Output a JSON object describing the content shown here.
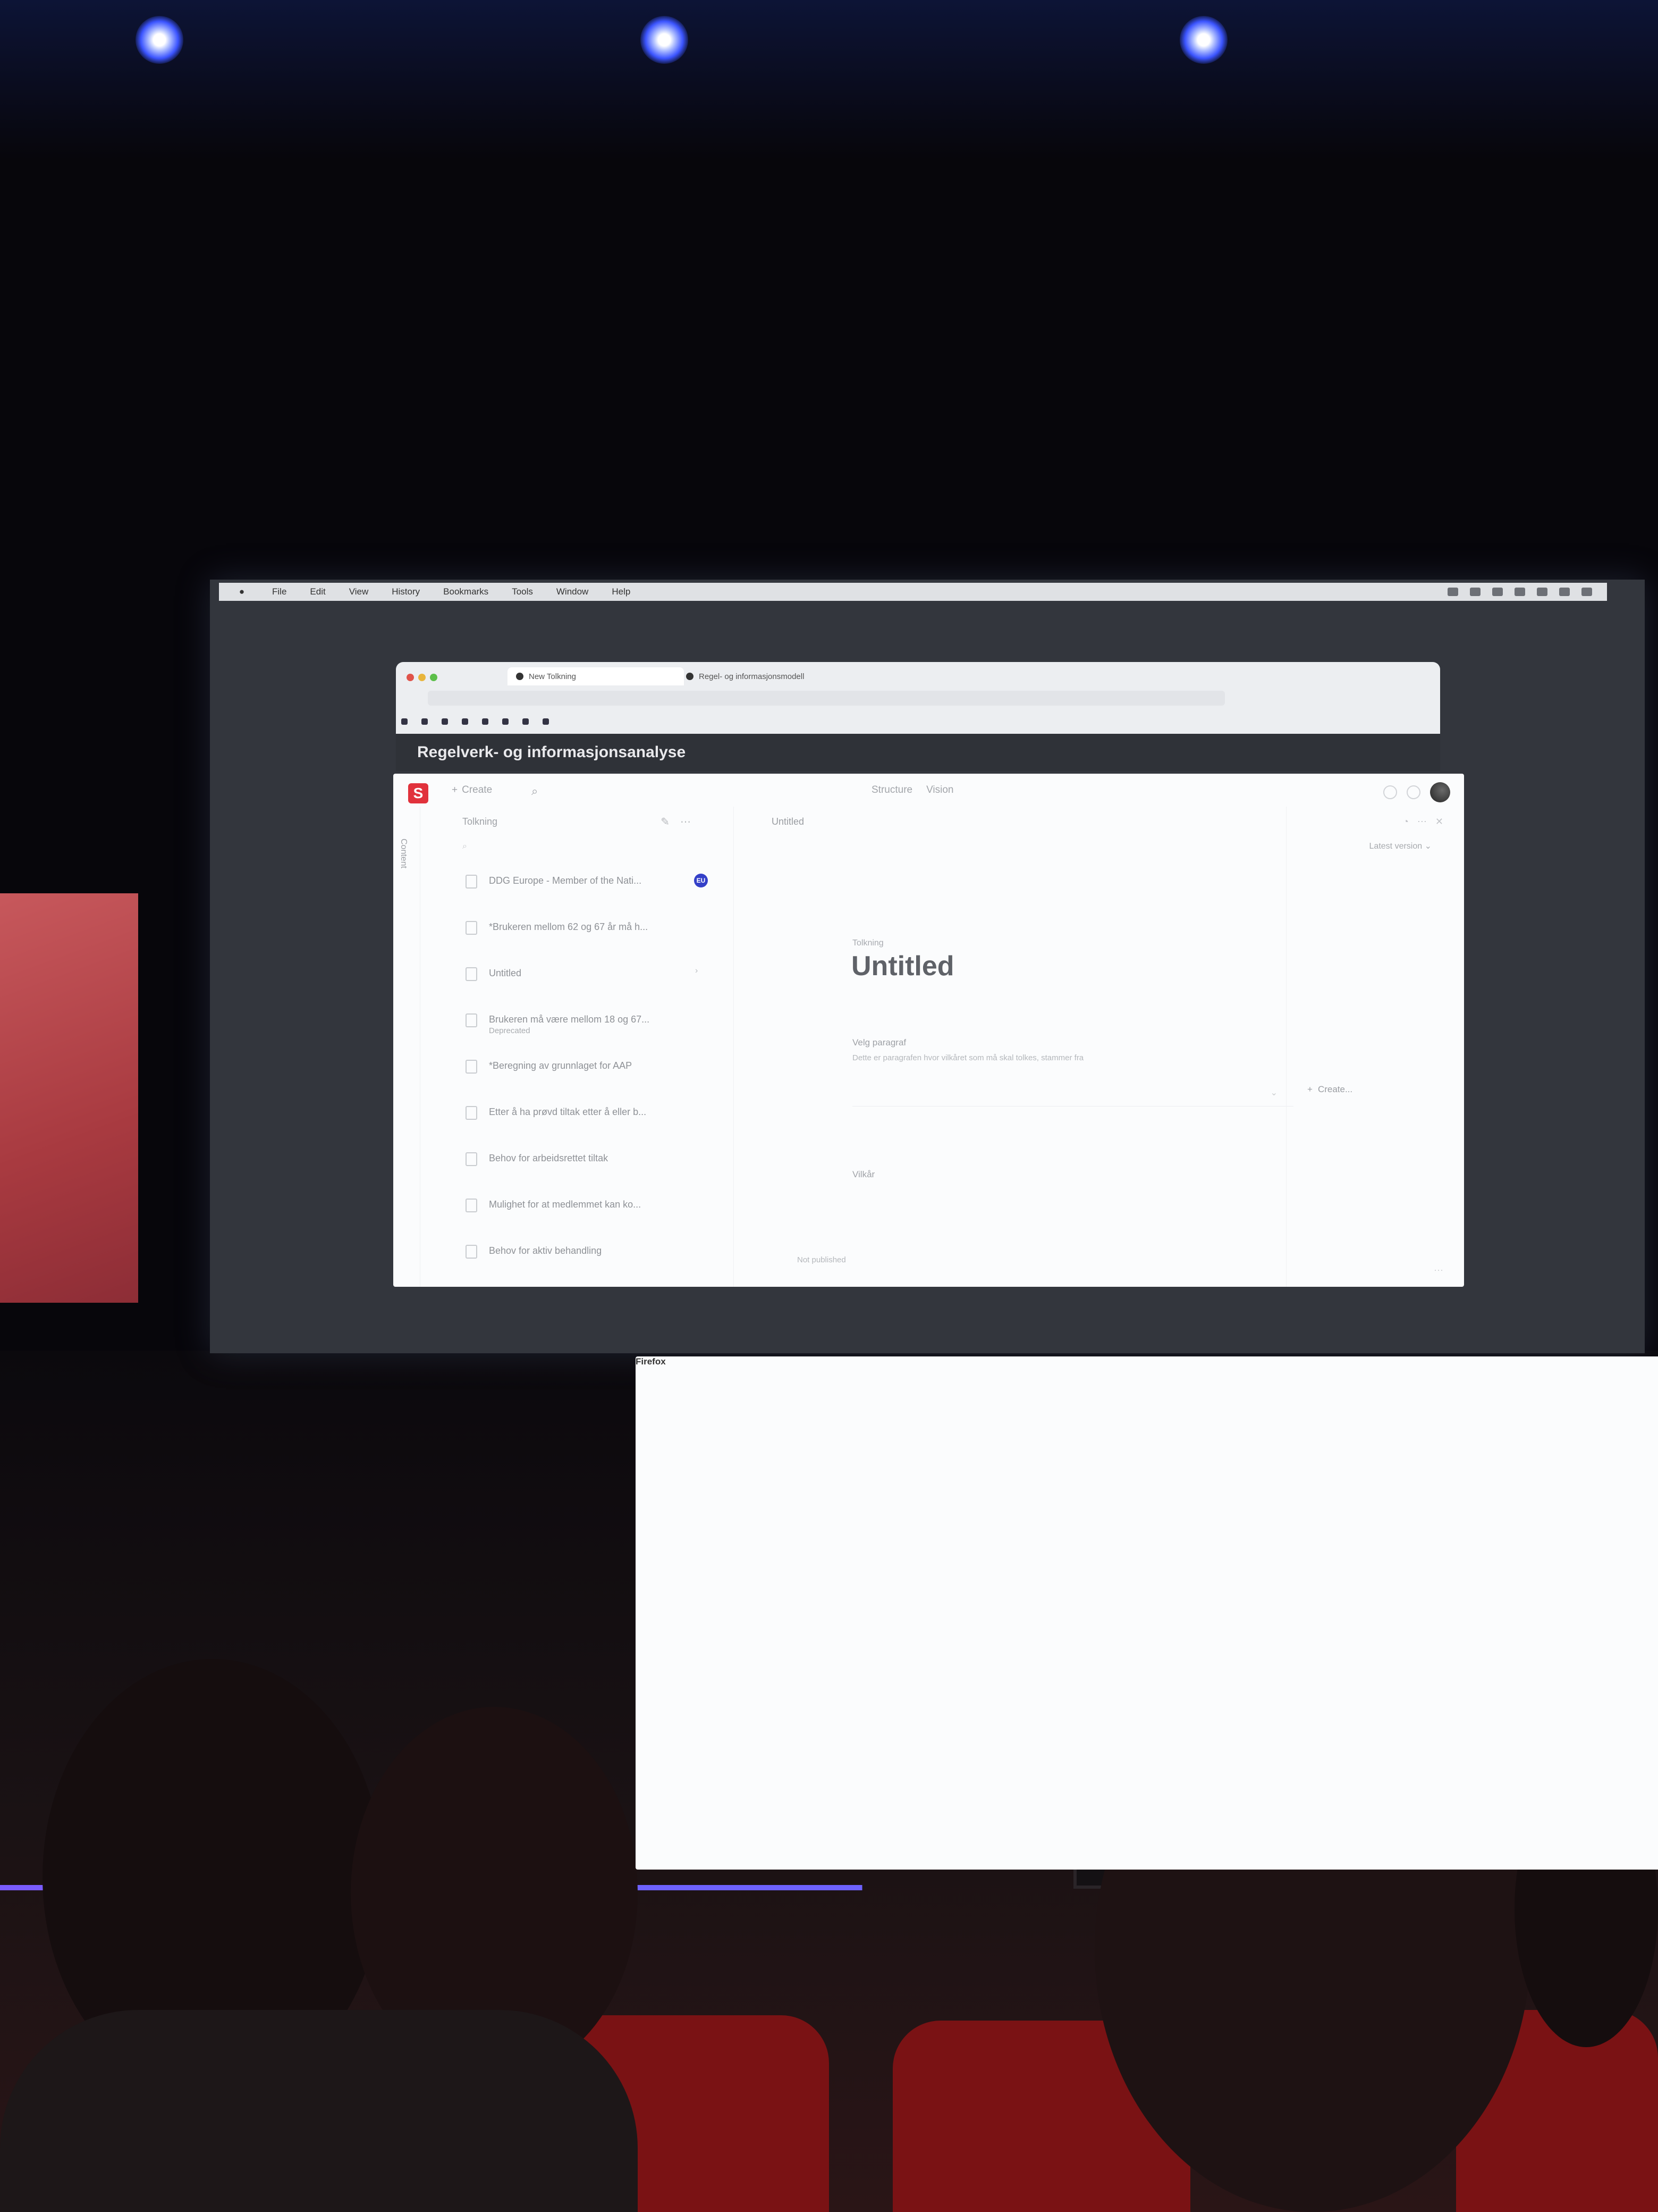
{
  "mac_menubar": {
    "apple_icon": "apple-icon",
    "app_name": "Firefox",
    "menus": [
      "File",
      "Edit",
      "View",
      "History",
      "Bookmarks",
      "Tools",
      "Window",
      "Help"
    ]
  },
  "browser": {
    "tabs": [
      {
        "label": "New Tolkning",
        "active": true
      },
      {
        "label": "Regel- og informasjonsmodell",
        "active": false
      }
    ]
  },
  "site": {
    "title": "Regelverk- og informasjonsanalyse"
  },
  "app": {
    "logo_letter": "S",
    "create_label": "Create",
    "nav_tabs": [
      "Structure",
      "Vision"
    ],
    "rail_label": "Content",
    "list_pane": {
      "title": "Tolkning",
      "items": [
        {
          "title": "DDG Europe - Member of the Nati...",
          "badge": "EU"
        },
        {
          "title": "*Brukeren mellom 62 og 67 år må h..."
        },
        {
          "title": "Untitled"
        },
        {
          "title": "Brukeren må være mellom 18 og 67...",
          "subtitle": "Deprecated"
        },
        {
          "title": "*Beregning av grunnlaget for AAP"
        },
        {
          "title": "Etter å ha prøvd tiltak etter å eller b..."
        },
        {
          "title": "Behov for arbeidsrettet tiltak"
        },
        {
          "title": "Mulighet for at medlemmet kan ko..."
        },
        {
          "title": "Behov for aktiv behandling"
        }
      ]
    },
    "editor": {
      "tab_title": "Untitled",
      "doc_type": "Tolkning",
      "doc_title": "Untitled",
      "paragraph_label": "Velg paragraf",
      "paragraph_description": "Dette er paragrafen hvor vilkåret som må skal tolkes, stammer fra",
      "create_label": "Create...",
      "conditions_label": "Vilkår",
      "publish_status": "Not published"
    },
    "right_pane": {
      "version_label": "Latest version"
    }
  },
  "colors": {
    "logo_red": "#e1323c",
    "badge_blue": "#3440c8",
    "header_dark": "#2f3238"
  }
}
